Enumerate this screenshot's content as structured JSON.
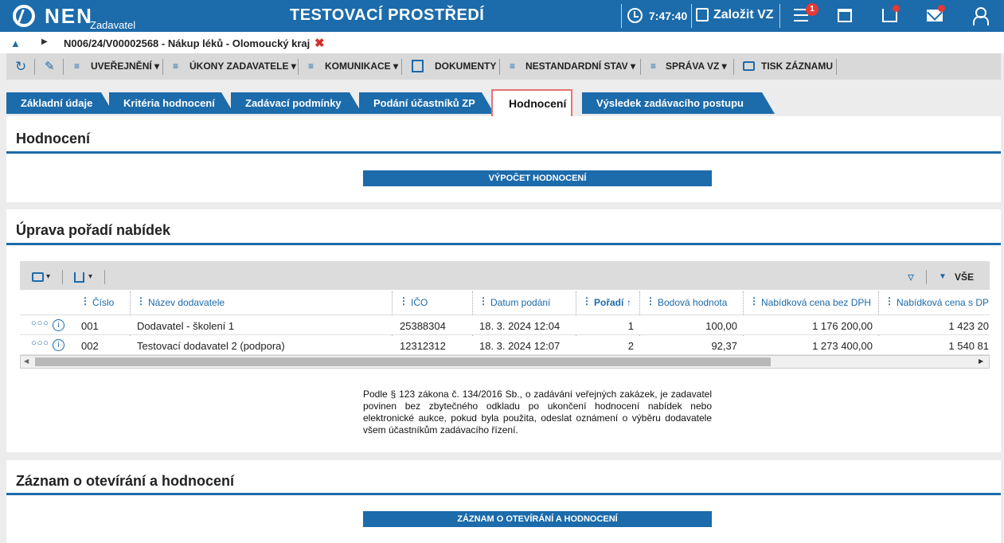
{
  "topbar": {
    "logo": "NEN",
    "logo_sub": "Zadavatel",
    "env_title": "TESTOVACÍ PROSTŘEDÍ",
    "time": "7:47:40",
    "create_label": "Založit VZ",
    "menu_badge": "1",
    "icons": [
      "clock-icon",
      "edit-icon",
      "menu-icon",
      "calendar-icon",
      "inbox-icon",
      "mail-icon",
      "user-icon"
    ],
    "accent_color": "#1c6bab"
  },
  "breadcrumb": {
    "text": "N006/24/V00002568 - Nákup léků - Olomoucký kraj",
    "close": "✖"
  },
  "toolbar": {
    "items": [
      "UVEŘEJNĚNÍ",
      "ÚKONY ZADAVATELE",
      "KOMUNIKACE",
      "DOKUMENTY",
      "NESTANDARDNÍ STAV",
      "SPRÁVA VZ",
      "TISK ZÁZNAMU"
    ]
  },
  "tabs": {
    "items": [
      "Základní údaje",
      "Kritéria hodnocení",
      "Zadávací podmínky",
      "Podání účastníků ZP",
      "Hodnocení",
      "Výsledek zadávacího postupu"
    ],
    "active": "Hodnocení"
  },
  "panel_hodnoceni": {
    "title": "Hodnocení",
    "button": "VÝPOČET HODNOCENÍ"
  },
  "panel_poradi": {
    "title": "Úprava pořadí nabídek",
    "grid": {
      "filter_all": "VŠE",
      "columns": [
        "Číslo",
        "Název dodavatele",
        "IČO",
        "Datum podání",
        "Pořadí",
        "Bodová hodnota",
        "Nabídková cena bez DPH",
        "Nabídková cena s DP"
      ],
      "rows": [
        {
          "cislo": "001",
          "nazev": "Dodavatel - školení 1",
          "ico": "25388304",
          "datum": "18. 3. 2024 12:04",
          "poradi": "1",
          "body": "100,00",
          "cena_bez": "1 176 200,00",
          "cena_s": "1 423 20"
        },
        {
          "cislo": "002",
          "nazev": "Testovací dodavatel 2 (podpora)",
          "ico": "12312312",
          "datum": "18. 3. 2024 12:07",
          "poradi": "2",
          "body": "92,37",
          "cena_bez": "1 273 400,00",
          "cena_s": "1 540 81"
        }
      ]
    },
    "note": "Podle § 123 zákona č. 134/2016 Sb., o zadávání veřejných zakázek, je zadavatel povinen bez zbytečného odkladu po ukončení hodnocení nabídek nebo elektronické aukce, pokud byla použita, odeslat oznámení o výběru dodavatele všem účastníkům zadávacího řízení."
  },
  "panel_zaznam": {
    "title": "Záznam o otevírání a hodnocení",
    "button": "ZÁZNAM O OTEVÍRÁNÍ A HODNOCENÍ"
  }
}
